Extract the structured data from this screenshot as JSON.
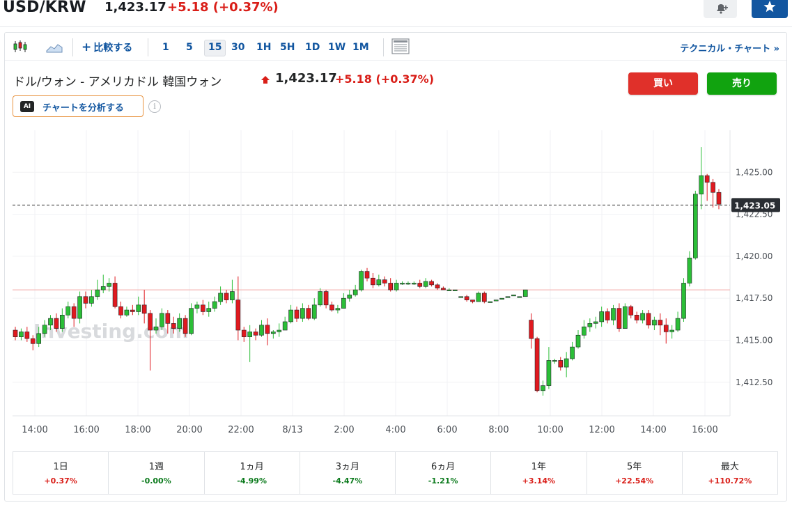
{
  "header": {
    "title": "USD/KRW",
    "price": "1,423.17",
    "change": "+5.18",
    "change_pct": "(+0.37%)"
  },
  "toolbar": {
    "compare_label": "比較する",
    "intervals": [
      "1",
      "5",
      "15",
      "30",
      "1H",
      "5H",
      "1D",
      "1W",
      "1M"
    ],
    "active_interval": "15",
    "technical_chart_label": "テクニカル・チャート »"
  },
  "info": {
    "pair_name": "ドル/ウォン - アメリカドル 韓国ウォン",
    "price": "1,423.17",
    "change": "+5.18",
    "change_pct": "(+0.37%)",
    "buy_label": "買い",
    "sell_label": "売り",
    "ai_badge": "AI",
    "ai_label": "チャートを分析する",
    "info_icon": "i"
  },
  "chart_data": {
    "type": "candlestick",
    "watermark": "Investing.com",
    "y_ticks": [
      "1,425.00",
      "1,422.50",
      "1,420.00",
      "1,417.50",
      "1,415.00",
      "1,412.50"
    ],
    "y_tick_values": [
      1425.0,
      1422.5,
      1420.0,
      1417.5,
      1415.0,
      1412.5
    ],
    "x_ticks": [
      "14:00",
      "16:00",
      "18:00",
      "20:00",
      "22:00",
      "8/13",
      "2:00",
      "4:00",
      "6:00",
      "8:00",
      "10:00",
      "12:00",
      "14:00",
      "16:00"
    ],
    "ylim": [
      1410.5,
      1427.5
    ],
    "last_price_label": "1,423.05",
    "last_price": 1423.05,
    "prev_close_level": 1418.0,
    "colors": {
      "up": "#2bbe37",
      "down": "#e0191f",
      "last_line": "#333333",
      "prev_close": "#f2a7a5"
    },
    "candles": [
      [
        1415.6,
        1415.2,
        1415.8,
        1415.0
      ],
      [
        1415.2,
        1415.5,
        1415.7,
        1415.0
      ],
      [
        1415.5,
        1415.1,
        1415.8,
        1414.9
      ],
      [
        1415.1,
        1414.8,
        1415.3,
        1414.4
      ],
      [
        1414.8,
        1415.4,
        1415.8,
        1414.6
      ],
      [
        1415.4,
        1415.9,
        1416.2,
        1415.2
      ],
      [
        1415.9,
        1416.3,
        1416.5,
        1415.6
      ],
      [
        1416.3,
        1415.7,
        1416.6,
        1415.5
      ],
      [
        1415.7,
        1416.5,
        1416.9,
        1415.5
      ],
      [
        1416.5,
        1417.0,
        1417.3,
        1416.3
      ],
      [
        1417.0,
        1416.3,
        1417.2,
        1415.8
      ],
      [
        1416.3,
        1417.6,
        1417.9,
        1416.0
      ],
      [
        1417.6,
        1417.2,
        1417.9,
        1416.9
      ],
      [
        1417.2,
        1417.6,
        1418.0,
        1417.0
      ],
      [
        1417.6,
        1418.0,
        1418.6,
        1417.4
      ],
      [
        1418.0,
        1418.2,
        1418.9,
        1417.8
      ],
      [
        1418.2,
        1418.4,
        1418.7,
        1417.9
      ],
      [
        1418.4,
        1417.0,
        1418.8,
        1416.9
      ],
      [
        1417.0,
        1416.5,
        1417.3,
        1416.3
      ],
      [
        1416.5,
        1416.8,
        1417.0,
        1416.4
      ],
      [
        1416.8,
        1416.7,
        1417.1,
        1416.5
      ],
      [
        1416.7,
        1417.1,
        1417.6,
        1416.5
      ],
      [
        1417.1,
        1416.6,
        1418.0,
        1416.0
      ],
      [
        1416.6,
        1415.6,
        1416.8,
        1413.2
      ],
      [
        1415.6,
        1415.8,
        1416.3,
        1415.4
      ],
      [
        1415.8,
        1416.6,
        1416.9,
        1415.6
      ],
      [
        1416.6,
        1416.0,
        1416.8,
        1415.4
      ],
      [
        1416.0,
        1415.7,
        1416.4,
        1415.4
      ],
      [
        1415.7,
        1416.3,
        1416.6,
        1415.5
      ],
      [
        1416.3,
        1415.4,
        1416.5,
        1415.2
      ],
      [
        1415.4,
        1416.9,
        1417.2,
        1415.3
      ],
      [
        1416.9,
        1417.1,
        1417.3,
        1416.6
      ],
      [
        1417.1,
        1416.7,
        1417.4,
        1416.5
      ],
      [
        1416.7,
        1416.9,
        1417.3,
        1416.4
      ],
      [
        1416.9,
        1417.3,
        1417.6,
        1416.7
      ],
      [
        1417.3,
        1417.8,
        1418.2,
        1417.1
      ],
      [
        1417.8,
        1417.4,
        1418.0,
        1417.2
      ],
      [
        1417.4,
        1417.9,
        1418.6,
        1417.2
      ],
      [
        1417.4,
        1415.6,
        1418.8,
        1415.0
      ],
      [
        1415.6,
        1415.2,
        1415.8,
        1414.9
      ],
      [
        1415.2,
        1415.5,
        1415.9,
        1413.7
      ],
      [
        1415.5,
        1415.3,
        1415.7,
        1415.0
      ],
      [
        1415.3,
        1415.9,
        1416.2,
        1415.2
      ],
      [
        1415.9,
        1415.4,
        1416.3,
        1414.7
      ],
      [
        1415.4,
        1415.5,
        1415.6,
        1415.1
      ],
      [
        1415.5,
        1415.6,
        1416.0,
        1415.2
      ],
      [
        1415.6,
        1416.1,
        1416.4,
        1415.6
      ],
      [
        1416.1,
        1416.8,
        1417.1,
        1416.0
      ],
      [
        1416.8,
        1416.3,
        1417.0,
        1416.1
      ],
      [
        1416.3,
        1416.9,
        1417.2,
        1416.1
      ],
      [
        1416.9,
        1416.3,
        1417.1,
        1416.2
      ],
      [
        1416.3,
        1417.1,
        1417.5,
        1416.2
      ],
      [
        1417.1,
        1417.9,
        1418.1,
        1417.0
      ],
      [
        1417.9,
        1417.1,
        1418.0,
        1416.9
      ],
      [
        1417.1,
        1416.8,
        1417.3,
        1416.7
      ],
      [
        1416.8,
        1416.9,
        1417.1,
        1416.6
      ],
      [
        1416.9,
        1417.5,
        1417.8,
        1416.9
      ],
      [
        1417.5,
        1417.7,
        1418.0,
        1417.3
      ],
      [
        1417.7,
        1418.0,
        1418.3,
        1417.6
      ],
      [
        1418.0,
        1419.1,
        1419.2,
        1417.9
      ],
      [
        1419.1,
        1418.7,
        1419.3,
        1418.5
      ],
      [
        1418.7,
        1418.3,
        1419.0,
        1418.1
      ],
      [
        1418.3,
        1418.6,
        1418.9,
        1418.2
      ],
      [
        1418.6,
        1418.4,
        1418.8,
        1418.2
      ],
      [
        1418.4,
        1418.0,
        1418.7,
        1417.9
      ],
      [
        1418.0,
        1418.4,
        1418.6,
        1417.9
      ],
      [
        1418.4,
        1418.4,
        1418.5,
        1418.3
      ],
      [
        1418.4,
        1418.4,
        1418.5,
        1418.3
      ],
      [
        1418.4,
        1418.4,
        1418.5,
        1418.3
      ],
      [
        1418.4,
        1418.2,
        1418.6,
        1418.1
      ],
      [
        1418.2,
        1418.5,
        1418.7,
        1418.1
      ],
      [
        1418.5,
        1418.3,
        1418.6,
        1418.2
      ],
      [
        1418.3,
        1418.1,
        1418.4,
        1418.0
      ],
      [
        1418.1,
        1418.0,
        1418.2,
        1418.0
      ],
      [
        1418.0,
        1418.0,
        1418.1,
        1418.0
      ],
      [
        1418.0,
        1418.0,
        1418.0,
        1418.0
      ],
      [
        1417.6,
        1417.6,
        1417.6,
        1417.6
      ],
      [
        1417.6,
        1417.4,
        1417.7,
        1417.3
      ],
      [
        1417.4,
        1417.3,
        1417.4,
        1417.2
      ],
      [
        1417.3,
        1417.8,
        1417.9,
        1417.3
      ],
      [
        1417.8,
        1417.3,
        1417.9,
        1417.2
      ],
      [
        1417.3,
        1417.3,
        1417.3,
        1417.3
      ],
      [
        1417.4,
        1417.4,
        1417.4,
        1417.4
      ],
      [
        1417.5,
        1417.5,
        1417.5,
        1417.5
      ],
      [
        1417.6,
        1417.6,
        1417.6,
        1417.6
      ],
      [
        1417.7,
        1417.7,
        1417.7,
        1417.7
      ],
      [
        1417.6,
        1417.6,
        1417.6,
        1417.6
      ],
      [
        1417.6,
        1418.0,
        1418.0,
        1417.6
      ],
      [
        1416.2,
        1415.1,
        1416.6,
        1414.5
      ],
      [
        1415.1,
        1412.0,
        1415.2,
        1411.9
      ],
      [
        1412.0,
        1412.3,
        1412.6,
        1411.7
      ],
      [
        1412.3,
        1413.8,
        1414.6,
        1412.1
      ],
      [
        1413.8,
        1413.8,
        1413.9,
        1413.6
      ],
      [
        1413.8,
        1413.4,
        1414.0,
        1413.2
      ],
      [
        1413.4,
        1413.9,
        1414.3,
        1412.8
      ],
      [
        1413.9,
        1414.6,
        1414.9,
        1413.8
      ],
      [
        1414.6,
        1415.3,
        1415.6,
        1414.5
      ],
      [
        1415.3,
        1415.8,
        1416.2,
        1415.1
      ],
      [
        1415.8,
        1416.0,
        1416.3,
        1415.5
      ],
      [
        1416.0,
        1416.1,
        1416.4,
        1415.7
      ],
      [
        1416.1,
        1416.7,
        1417.0,
        1415.8
      ],
      [
        1416.7,
        1416.2,
        1416.9,
        1416.0
      ],
      [
        1416.2,
        1416.9,
        1417.1,
        1415.9
      ],
      [
        1416.9,
        1415.7,
        1417.2,
        1415.5
      ],
      [
        1415.7,
        1417.0,
        1417.2,
        1415.7
      ],
      [
        1417.0,
        1416.5,
        1417.1,
        1416.3
      ],
      [
        1416.5,
        1416.2,
        1416.7,
        1416.0
      ],
      [
        1416.2,
        1416.6,
        1416.8,
        1416.0
      ],
      [
        1416.6,
        1415.9,
        1416.8,
        1415.7
      ],
      [
        1415.9,
        1416.2,
        1416.4,
        1415.6
      ],
      [
        1416.2,
        1415.9,
        1416.6,
        1415.3
      ],
      [
        1415.9,
        1415.5,
        1416.3,
        1414.8
      ],
      [
        1415.5,
        1415.6,
        1415.9,
        1415.1
      ],
      [
        1415.6,
        1416.3,
        1416.7,
        1415.5
      ],
      [
        1416.3,
        1418.4,
        1418.7,
        1416.1
      ],
      [
        1418.4,
        1419.9,
        1420.3,
        1418.2
      ],
      [
        1419.9,
        1423.7,
        1423.9,
        1419.8
      ],
      [
        1423.7,
        1424.8,
        1426.5,
        1422.8
      ],
      [
        1424.8,
        1424.4,
        1424.9,
        1423.3
      ],
      [
        1424.4,
        1423.8,
        1424.6,
        1422.9
      ],
      [
        1423.8,
        1423.1,
        1424.0,
        1422.8
      ]
    ]
  },
  "performance": [
    {
      "label": "1日",
      "value": "+0.37%",
      "dir": "pos"
    },
    {
      "label": "1週",
      "value": "-0.00%",
      "dir": "neg"
    },
    {
      "label": "1ヵ月",
      "value": "-4.99%",
      "dir": "neg"
    },
    {
      "label": "3ヵ月",
      "value": "-4.47%",
      "dir": "neg"
    },
    {
      "label": "6ヵ月",
      "value": "-1.21%",
      "dir": "neg"
    },
    {
      "label": "1年",
      "value": "+3.14%",
      "dir": "pos"
    },
    {
      "label": "5年",
      "value": "+22.54%",
      "dir": "pos"
    },
    {
      "label": "最大",
      "value": "+110.72%",
      "dir": "pos"
    }
  ]
}
